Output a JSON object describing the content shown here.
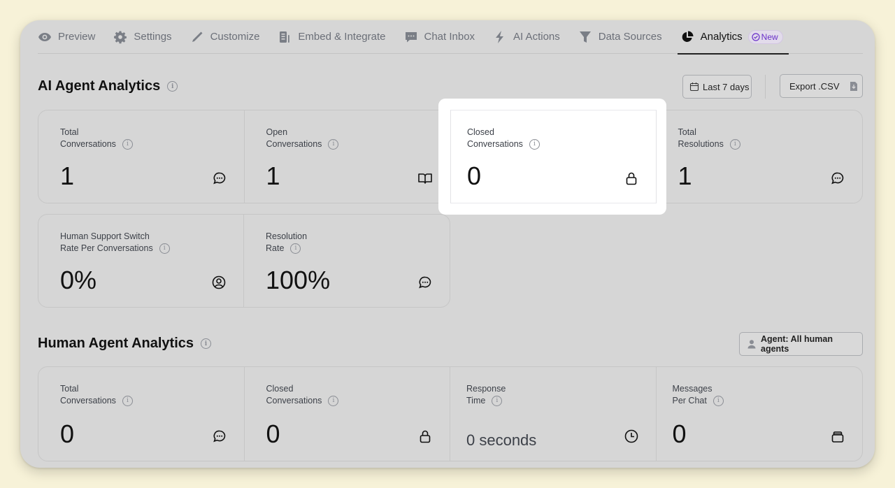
{
  "tabs": [
    {
      "label": "Preview",
      "icon": "eye-icon"
    },
    {
      "label": "Settings",
      "icon": "gear-icon"
    },
    {
      "label": "Customize",
      "icon": "pencil-icon"
    },
    {
      "label": "Embed & Integrate",
      "icon": "embed-icon"
    },
    {
      "label": "Chat Inbox",
      "icon": "chat-bubble-icon"
    },
    {
      "label": "AI Actions",
      "icon": "lightning-icon"
    },
    {
      "label": "Data Sources",
      "icon": "funnel-icon"
    },
    {
      "label": "Analytics",
      "icon": "pie-chart-icon",
      "active": true,
      "badge": "New"
    }
  ],
  "ai_section": {
    "title": "AI Agent Analytics",
    "date_range_button": "Last 7 days",
    "export_button": "Export .CSV",
    "cards_row1": [
      {
        "label_line1": "Total",
        "label_line2": "Conversations",
        "value": "1",
        "icon": "chat-dots-icon"
      },
      {
        "label_line1": "Open",
        "label_line2": "Conversations",
        "value": "1",
        "icon": "open-book-icon"
      },
      {
        "label_line1": "Closed",
        "label_line2": "Conversations",
        "value": "0",
        "icon": "lock-icon",
        "highlighted": true
      },
      {
        "label_line1": "Total",
        "label_line2": "Resolutions",
        "value": "1",
        "icon": "chat-dots-icon"
      }
    ],
    "cards_row2": [
      {
        "label_line1": "Human Support Switch",
        "label_line2": "Rate Per Conversations",
        "value": "0%",
        "icon": "user-circle-icon"
      },
      {
        "label_line1": "Resolution",
        "label_line2": "Rate",
        "value": "100%",
        "icon": "chat-dots-icon"
      }
    ]
  },
  "human_section": {
    "title": "Human Agent Analytics",
    "agent_filter_button": "Agent: All human agents",
    "cards": [
      {
        "label_line1": "Total",
        "label_line2": "Conversations",
        "value": "0",
        "icon": "chat-dots-icon"
      },
      {
        "label_line1": "Closed",
        "label_line2": "Conversations",
        "value": "0",
        "icon": "lock-icon"
      },
      {
        "label_line1": "Response",
        "label_line2": "Time",
        "value": "0 seconds",
        "icon": "clock-icon"
      },
      {
        "label_line1": "Messages",
        "label_line2": "Per Chat",
        "value": "0",
        "icon": "inbox-stack-icon"
      }
    ]
  },
  "colors": {
    "page_background": "#f7f2d8",
    "window_background": "#d6d6d6",
    "badge_accent": "#6a2fc9",
    "spotlight": "#ffffff"
  }
}
